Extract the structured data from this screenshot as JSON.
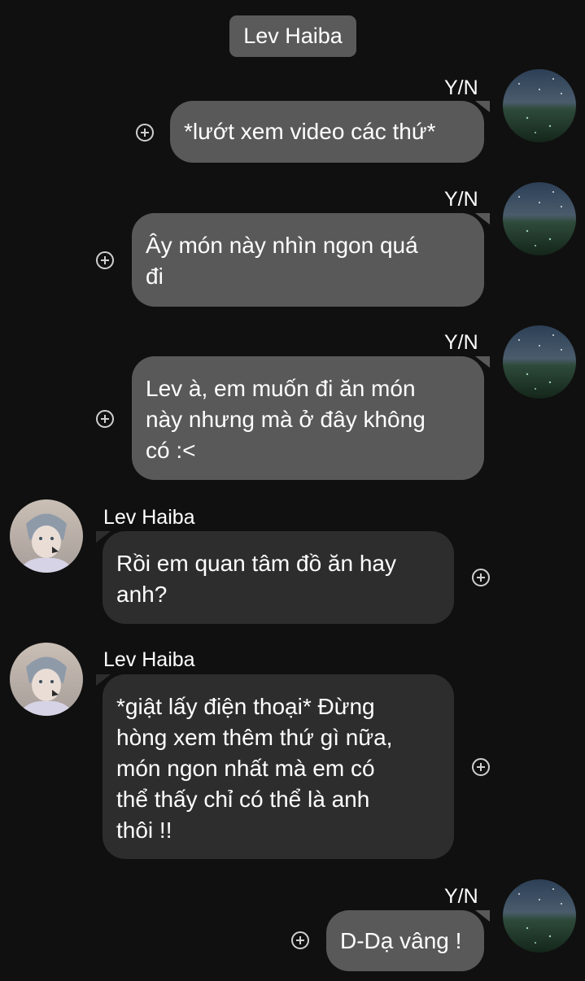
{
  "header": {
    "title": "Lev Haiba"
  },
  "messages": [
    {
      "sender": "Y/N",
      "direction": "outgoing",
      "text": "*lướt xem video các thứ*"
    },
    {
      "sender": "Y/N",
      "direction": "outgoing",
      "text": "Ây món này nhìn ngon quá\nđi"
    },
    {
      "sender": "Y/N",
      "direction": "outgoing",
      "text": "Lev à, em muốn đi ăn món\nnày nhưng mà ở đây không\ncó :<"
    },
    {
      "sender": "Lev Haiba",
      "direction": "incoming",
      "text": "Rồi em quan tâm đồ ăn hay\nanh?"
    },
    {
      "sender": "Lev Haiba",
      "direction": "incoming",
      "text": "*giật lấy điện thoại* Đừng\nhòng xem thêm thứ gì nữa,\nmón ngon nhất mà em có\nthể thấy chỉ có thể là anh\nthôi !!"
    },
    {
      "sender": "Y/N",
      "direction": "outgoing",
      "text": "D-Dạ vâng !"
    }
  ],
  "icons": {
    "reaction": "add-circle-icon",
    "yn_avatar": "night-sky-field-avatar",
    "lev_avatar": "anime-boy-avatar"
  },
  "colors": {
    "background": "#101010",
    "outgoing_bubble": "#595959",
    "incoming_bubble": "#2d2d2d",
    "header_chip": "#5a5a5a"
  }
}
